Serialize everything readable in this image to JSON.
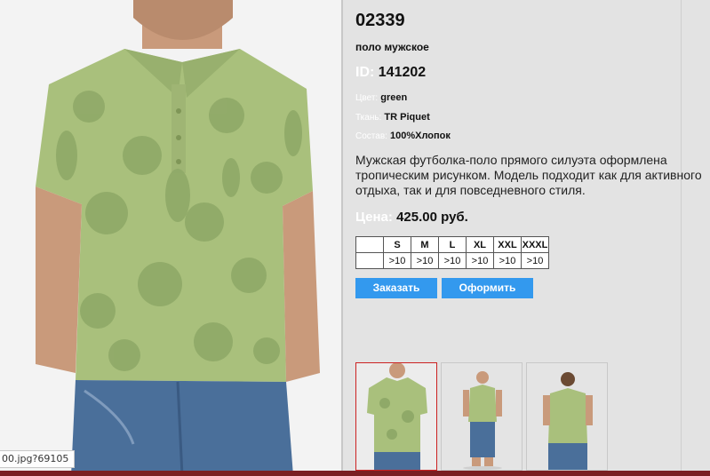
{
  "product": {
    "code": "02339",
    "subtitle": "поло мужское",
    "id_label": "ID:",
    "id_value": "141202",
    "color_label": "Цвет:",
    "color_value": "green",
    "fabric_label": "Ткань:",
    "fabric_value": "TR Piquet",
    "composition_label": "Состав:",
    "composition_value": "100%Хлопок",
    "description": "Мужская футболка-поло прямого силуэта оформлена тропическим рисунком. Модель подходит как для активного отдыха, так и для повседневного стиля.",
    "price_label": "Цена:",
    "price_value": "425.00 руб."
  },
  "sizes": {
    "headers": [
      "S",
      "M",
      "L",
      "XL",
      "XXL",
      "XXXL"
    ],
    "stock": [
      ">10",
      ">10",
      ">10",
      ">10",
      ">10",
      ">10"
    ]
  },
  "buttons": {
    "order": "Заказать",
    "checkout": "Оформить"
  },
  "status_url": "00.jpg?69105",
  "colors": {
    "shirt": "#a9c07c",
    "shirt_pattern": "#8fa968",
    "jeans": "#4a6f9a",
    "accent_button": "#3399ee",
    "selected_thumb_border": "#cc2222"
  }
}
